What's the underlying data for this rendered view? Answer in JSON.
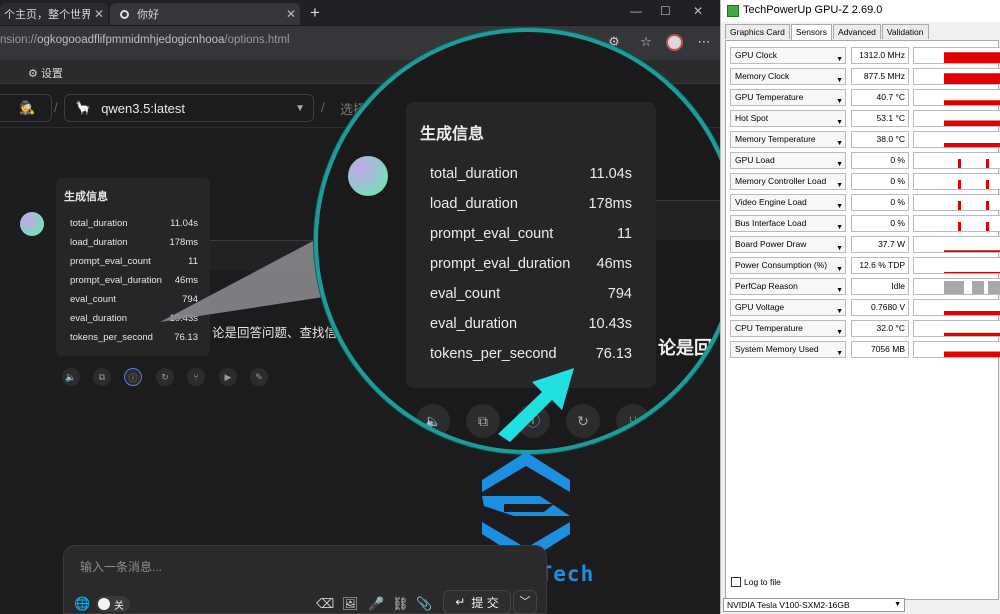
{
  "browser": {
    "tabs": [
      {
        "title": "个主页，整个世界",
        "close": "✕"
      },
      {
        "title": "你好",
        "close": "✕"
      }
    ],
    "new_tab": "+",
    "url": {
      "scheme": "nsion://",
      "host": "ogkogooadflifpmmidmhjedogicnhooa",
      "path": "/options.html"
    },
    "bookmark": "设置",
    "model_name": "qwen3.5:latest",
    "select_placeholder": "选择",
    "answer_snippet": "论是回答问题、查找信",
    "composer_placeholder": "输入一条消息...",
    "toggle_label": "关",
    "submit_label": "提 交"
  },
  "gen_info": {
    "title": "生成信息",
    "rows": [
      {
        "key": "total_duration",
        "value": "11.04s"
      },
      {
        "key": "load_duration",
        "value": "178ms"
      },
      {
        "key": "prompt_eval_count",
        "value": "11"
      },
      {
        "key": "prompt_eval_duration",
        "value": "46ms"
      },
      {
        "key": "eval_count",
        "value": "794"
      },
      {
        "key": "eval_duration",
        "value": "10.43s"
      },
      {
        "key": "tokens_per_second",
        "value": "76.13"
      }
    ]
  },
  "magnifier": {
    "answer_snippet": "论是回",
    "select_placeholder": "选"
  },
  "watermark": {
    "text": "Innov8Tech"
  },
  "gpuz": {
    "title": "TechPowerUp GPU-Z 2.69.0",
    "tabs": [
      "Graphics Card",
      "Sensors",
      "Advanced",
      "Validation"
    ],
    "active_tab": "Sensors",
    "sensors": [
      {
        "name": "GPU Clock",
        "value": "1312.0 MHz",
        "level": 0.85
      },
      {
        "name": "Memory Clock",
        "value": "877.5 MHz",
        "level": 0.85
      },
      {
        "name": "GPU Temperature",
        "value": "40.7 °C",
        "level": 0.45
      },
      {
        "name": "Hot Spot",
        "value": "53.1 °C",
        "level": 0.5
      },
      {
        "name": "Memory Temperature",
        "value": "38.0 °C",
        "level": 0.4
      },
      {
        "name": "GPU Load",
        "value": "0 %",
        "level": 0.0
      },
      {
        "name": "Memory Controller Load",
        "value": "0 %",
        "level": 0.0
      },
      {
        "name": "Video Engine Load",
        "value": "0 %",
        "level": 0.0
      },
      {
        "name": "Bus Interface Load",
        "value": "0 %",
        "level": 0.0
      },
      {
        "name": "Board Power Draw",
        "value": "37.7 W",
        "level": 0.25
      },
      {
        "name": "Power Consumption (%)",
        "value": "12.6 % TDP",
        "level": 0.2
      },
      {
        "name": "PerfCap Reason",
        "value": "Idle",
        "level": 0.0
      },
      {
        "name": "GPU Voltage",
        "value": "0.7680 V",
        "level": 0.4
      },
      {
        "name": "CPU Temperature",
        "value": "32.0 °C",
        "level": 0.35
      },
      {
        "name": "System Memory Used",
        "value": "7056 MB",
        "level": 0.5
      }
    ],
    "log_to_file": "Log to file",
    "gpu_select": "NVIDIA Tesla V100-SXM2-16GB",
    "colors": {
      "graph": "#e00000",
      "perfcap": "#a8a8a8"
    }
  }
}
